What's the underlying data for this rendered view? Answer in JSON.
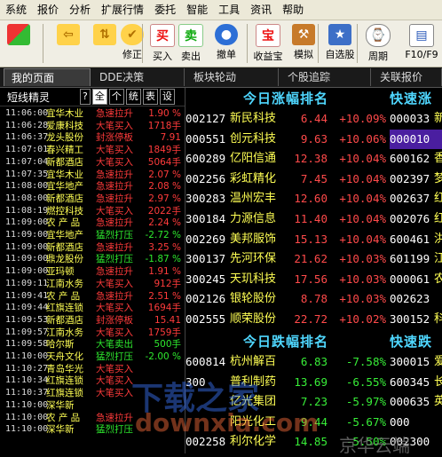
{
  "menu": [
    "系统",
    "报价",
    "分析",
    "扩展行情",
    "委托",
    "智能",
    "工具",
    "资讯",
    "帮助"
  ],
  "toolbar": {
    "buttons": [
      {
        "label": "",
        "icon": "grid-icon"
      },
      {
        "label": "",
        "icon": "back-arrow-icon"
      },
      {
        "label": "",
        "icon": "up-down-icon"
      },
      {
        "label": "修正",
        "icon": "fix-icon"
      },
      {
        "label": "买入",
        "glyph": "买",
        "icon": "buy-icon"
      },
      {
        "label": "卖出",
        "glyph": "卖",
        "icon": "sell-icon"
      },
      {
        "label": "撤单",
        "icon": "cancel-order-icon"
      },
      {
        "label": "收益宝",
        "glyph": "宝",
        "icon": "treasure-icon"
      },
      {
        "label": "模拟",
        "icon": "hammer-icon"
      },
      {
        "label": "自选股",
        "icon": "star-icon"
      },
      {
        "label": "周期",
        "icon": "clock-icon"
      },
      {
        "label": "F10/F9",
        "icon": "f10-icon"
      }
    ]
  },
  "tabs": [
    "我的页面",
    "DDE决策",
    "板块轮动",
    "个股追踪",
    "关联报价"
  ],
  "left_panel": {
    "title": "短线精灵",
    "filters": [
      "?",
      "全",
      "个",
      "统",
      "表",
      "设"
    ],
    "rows": [
      {
        "time": "11:06:00",
        "name": "宜华木业",
        "type": "急速拉升",
        "value": "1.90 %",
        "tcolor": "#ff3b3b",
        "vcolor": "#ff3b3b"
      },
      {
        "time": "11:06:28",
        "name": "爱康科技",
        "type": "大笔买入",
        "value": "1718手",
        "tcolor": "#ff3b3b",
        "vcolor": "#ff3b3b"
      },
      {
        "time": "11:06:37",
        "name": "龙头股份",
        "type": "封涨停板",
        "value": "7.91",
        "tcolor": "#ff3b3b",
        "vcolor": "#ff3b3b"
      },
      {
        "time": "11:07:01",
        "name": "春兴精工",
        "type": "大笔买入",
        "value": "1849手",
        "tcolor": "#ff3b3b",
        "vcolor": "#ff3b3b"
      },
      {
        "time": "11:07:04",
        "name": "新都酒店",
        "type": "大笔买入",
        "value": "5064手",
        "tcolor": "#ff3b3b",
        "vcolor": "#ff3b3b"
      },
      {
        "time": "11:07:35",
        "name": "宜华木业",
        "type": "急速拉升",
        "value": "2.07 %",
        "tcolor": "#ff3b3b",
        "vcolor": "#ff3b3b"
      },
      {
        "time": "11:08:00",
        "name": "宜华地产",
        "type": "急速拉升",
        "value": "2.08 %",
        "tcolor": "#ff3b3b",
        "vcolor": "#ff3b3b"
      },
      {
        "time": "11:08:00",
        "name": "新都酒店",
        "type": "急速拉升",
        "value": "2.97 %",
        "tcolor": "#ff3b3b",
        "vcolor": "#ff3b3b"
      },
      {
        "time": "11:08:19",
        "name": "燃控科技",
        "type": "大笔买入",
        "value": "2022手",
        "tcolor": "#ff3b3b",
        "vcolor": "#ff3b3b"
      },
      {
        "time": "11:09:00",
        "name": "农 产 品",
        "type": "急速拉升",
        "value": "2.24 %",
        "tcolor": "#ff3b3b",
        "vcolor": "#ff3b3b"
      },
      {
        "time": "11:09:00",
        "name": "宜华地产",
        "type": "猛烈打压",
        "value": "-2.72 %",
        "tcolor": "#2ee82e",
        "vcolor": "#2ee82e"
      },
      {
        "time": "11:09:00",
        "name": "新都酒店",
        "type": "急速拉升",
        "value": "3.25 %",
        "tcolor": "#ff3b3b",
        "vcolor": "#ff3b3b"
      },
      {
        "time": "11:09:00",
        "name": "鼎龙股份",
        "type": "猛烈打压",
        "value": "-1.87 %",
        "tcolor": "#2ee82e",
        "vcolor": "#2ee82e"
      },
      {
        "time": "11:09:00",
        "name": "亚玛顿",
        "type": "急速拉升",
        "value": "1.91 %",
        "tcolor": "#ff3b3b",
        "vcolor": "#ff3b3b"
      },
      {
        "time": "11:09:11",
        "name": "江南水务",
        "type": "大笔买入",
        "value": "912手",
        "tcolor": "#ff3b3b",
        "vcolor": "#ff3b3b"
      },
      {
        "time": "11:09:41",
        "name": "农 产 品",
        "type": "急速拉升",
        "value": "2.51 %",
        "tcolor": "#ff3b3b",
        "vcolor": "#ff3b3b"
      },
      {
        "time": "11:09:44",
        "name": "红旗连锁",
        "type": "大笔买入",
        "value": "1694手",
        "tcolor": "#ff3b3b",
        "vcolor": "#ff3b3b"
      },
      {
        "time": "11:09:53",
        "name": "新都酒店",
        "type": "封涨停板",
        "value": "15.41",
        "tcolor": "#ff3b3b",
        "vcolor": "#ff3b3b"
      },
      {
        "time": "11:09:57",
        "name": "江南水务",
        "type": "大笔买入",
        "value": "1759手",
        "tcolor": "#ff3b3b",
        "vcolor": "#ff3b3b"
      },
      {
        "time": "11:09:58",
        "name": "哈尔斯",
        "type": "大笔卖出",
        "value": "500手",
        "tcolor": "#2ee82e",
        "vcolor": "#2ee82e"
      },
      {
        "time": "11:10:00",
        "name": "天舟文化",
        "type": "猛烈打压",
        "value": "-2.00 %",
        "tcolor": "#2ee82e",
        "vcolor": "#2ee82e"
      },
      {
        "time": "11:10:27",
        "name": "青岛华光",
        "type": "大笔买入",
        "value": "",
        "tcolor": "#ff3b3b",
        "vcolor": "#ff3b3b"
      },
      {
        "time": "11:10:34",
        "name": "红旗连锁",
        "type": "大笔买入",
        "value": "",
        "tcolor": "#ff3b3b",
        "vcolor": "#ff3b3b"
      },
      {
        "time": "11:10:37",
        "name": "红旗连锁",
        "type": "大笔买入",
        "value": "",
        "tcolor": "#ff3b3b",
        "vcolor": "#ff3b3b"
      },
      {
        "time": "11:10:00",
        "name": "深华新",
        "type": "",
        "value": "",
        "tcolor": "#ff3b3b",
        "vcolor": "#ff3b3b"
      },
      {
        "time": "11:10:00",
        "name": "农 产 品",
        "type": "急速拉升",
        "value": "",
        "tcolor": "#ff3b3b",
        "vcolor": "#ff3b3b"
      },
      {
        "time": "11:10:00",
        "name": "深华新",
        "type": "猛烈打压",
        "value": "",
        "tcolor": "#2ee82e",
        "vcolor": "#2ee82e"
      }
    ]
  },
  "gainers": {
    "title": "今日涨幅排名",
    "rows": [
      {
        "code": "002127",
        "name": "新民科技",
        "price": "6.44",
        "pct": "+10.09%"
      },
      {
        "code": "000551",
        "name": "创元科技",
        "price": "9.63",
        "pct": "+10.06%"
      },
      {
        "code": "600289",
        "name": "亿阳信通",
        "price": "12.38",
        "pct": "+10.04%"
      },
      {
        "code": "002256",
        "name": "彩虹精化",
        "price": "7.45",
        "pct": "+10.04%"
      },
      {
        "code": "300283",
        "name": "温州宏丰",
        "price": "12.60",
        "pct": "+10.04%"
      },
      {
        "code": "300184",
        "name": "力源信息",
        "price": "11.40",
        "pct": "+10.04%"
      },
      {
        "code": "002269",
        "name": "美邦服饰",
        "price": "15.13",
        "pct": "+10.04%"
      },
      {
        "code": "300137",
        "name": "先河环保",
        "price": "21.62",
        "pct": "+10.03%"
      },
      {
        "code": "300245",
        "name": "天玑科技",
        "price": "17.56",
        "pct": "+10.03%"
      },
      {
        "code": "002126",
        "name": "银轮股份",
        "price": "8.78",
        "pct": "+10.03%"
      },
      {
        "code": "002555",
        "name": "顺荣股份",
        "price": "22.72",
        "pct": "+10.02%"
      }
    ]
  },
  "losers": {
    "title": "今日跌幅排名",
    "rows": [
      {
        "code": "600814",
        "name": "杭州解百",
        "price": "6.83",
        "pct": "-7.58%"
      },
      {
        "code": "300",
        "name": "普利制药",
        "price": "13.69",
        "pct": "-6.55%"
      },
      {
        "code": "",
        "name": "亿光集团",
        "price": "7.23",
        "pct": "-5.97%"
      },
      {
        "code": "",
        "name": "阳光化工",
        "price": "9.44",
        "pct": "-5.67%"
      },
      {
        "code": "002258",
        "name": "利尔化学",
        "price": "14.85",
        "pct": "-5.50%"
      }
    ]
  },
  "fast_up": {
    "title": "快速涨",
    "rows": [
      "000033",
      "000010",
      "600162",
      "002397",
      "002637",
      "002076",
      "600461",
      "601199",
      "000061",
      "002623",
      "300152"
    ],
    "names": [
      "新",
      "",
      "香",
      "梦",
      "红",
      "红",
      "洪",
      "江",
      "农",
      "",
      "科"
    ]
  },
  "fast_down": {
    "title": "快速跌",
    "rows": [
      "300015",
      "600345",
      "000635",
      "000",
      "002300"
    ],
    "names": [
      "爱",
      "长",
      "英",
      "",
      ""
    ]
  },
  "watermark": {
    "line1": "下载之家",
    "line2": "downxia.com",
    "line3": "京华云端"
  }
}
